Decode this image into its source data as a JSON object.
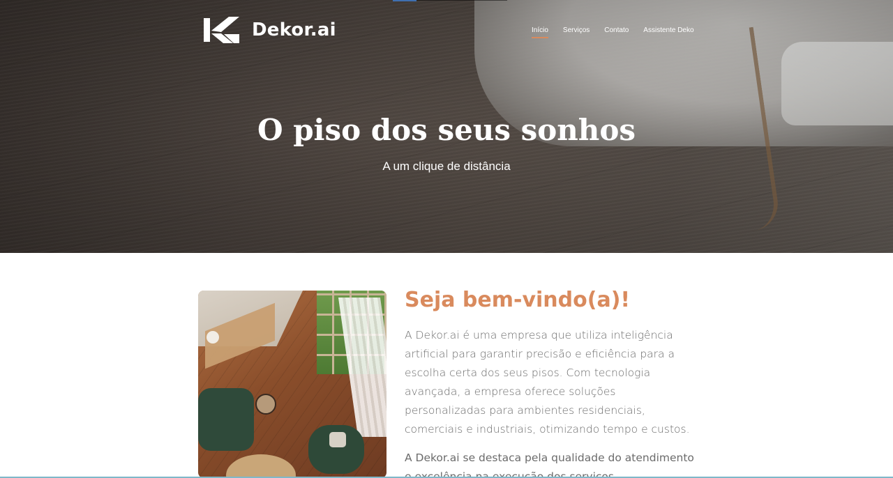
{
  "header": {
    "logo_text": "Dekor.ai",
    "nav": [
      {
        "label": "Início",
        "active": true
      },
      {
        "label": "Serviços",
        "active": false
      },
      {
        "label": "Contato",
        "active": false
      },
      {
        "label": "Assistente Deko",
        "active": false
      }
    ]
  },
  "hero": {
    "title": "O piso dos seus sonhos",
    "subtitle": "A um clique de distância"
  },
  "about": {
    "title": "Seja bem-vindo(a)!",
    "paragraph1": "A Dekor.ai é uma empresa que utiliza inteligência artificial para garantir precisão e eficiência para a escolha certa dos seus pisos. Com tecnologia avançada, a empresa oferece soluções personalizadas para ambientes residenciais, comerciais e industriais, otimizando tempo e custos.",
    "paragraph2": "A Dekor.ai se destaca pela qualidade do atendimento e excelência na execução dos serviços."
  },
  "colors": {
    "accent": "#d98a5d",
    "text_muted": "#6b6b6b",
    "hero_overlay": "#4a423d"
  },
  "icons": {
    "logo": "dekor-k-logo-icon"
  }
}
